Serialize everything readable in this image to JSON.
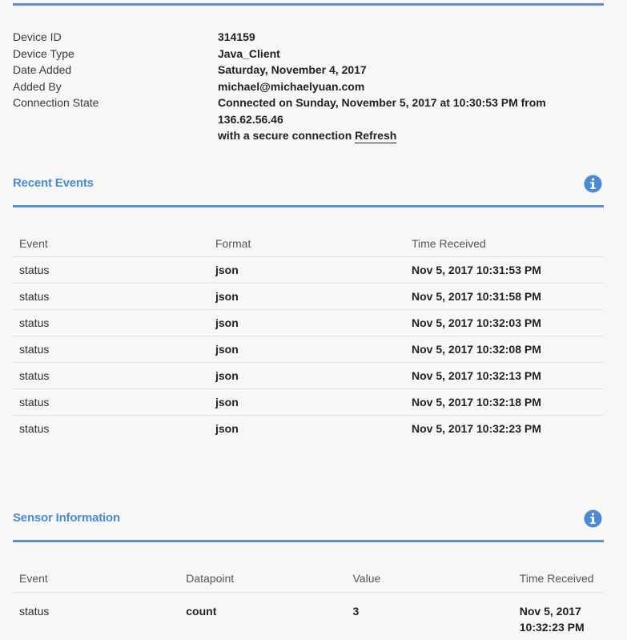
{
  "device": {
    "rows": [
      {
        "label": "Device ID",
        "value": "314159"
      },
      {
        "label": "Device Type",
        "value": "Java_Client"
      },
      {
        "label": "Date Added",
        "value": "Saturday, November 4, 2017"
      },
      {
        "label": "Added By",
        "value": "michael@michaelyuan.com"
      },
      {
        "label": "Connection State",
        "value": "Connected on Sunday, November 5, 2017 at 10:30:53 PM from 136.62.56.46"
      }
    ],
    "connection_suffix": "with a secure connection ",
    "refresh_label": "Refresh"
  },
  "recent_events": {
    "title": "Recent Events",
    "columns": [
      "Event",
      "Format",
      "Time Received"
    ],
    "rows": [
      [
        "status",
        "json",
        "Nov 5, 2017 10:31:53 PM"
      ],
      [
        "status",
        "json",
        "Nov 5, 2017 10:31:58 PM"
      ],
      [
        "status",
        "json",
        "Nov 5, 2017 10:32:03 PM"
      ],
      [
        "status",
        "json",
        "Nov 5, 2017 10:32:08 PM"
      ],
      [
        "status",
        "json",
        "Nov 5, 2017 10:32:13 PM"
      ],
      [
        "status",
        "json",
        "Nov 5, 2017 10:32:18 PM"
      ],
      [
        "status",
        "json",
        "Nov 5, 2017 10:32:23 PM"
      ]
    ]
  },
  "sensor_information": {
    "title": "Sensor Information",
    "columns": [
      "Event",
      "Datapoint",
      "Value",
      "Time Received"
    ],
    "rows": [
      [
        "status",
        "count",
        "3",
        "Nov 5, 2017 10:32:23 PM"
      ]
    ]
  },
  "icons": {
    "info": "info-icon"
  },
  "colors": {
    "accent": "#5b8fd0",
    "title": "#4b8bd6"
  }
}
